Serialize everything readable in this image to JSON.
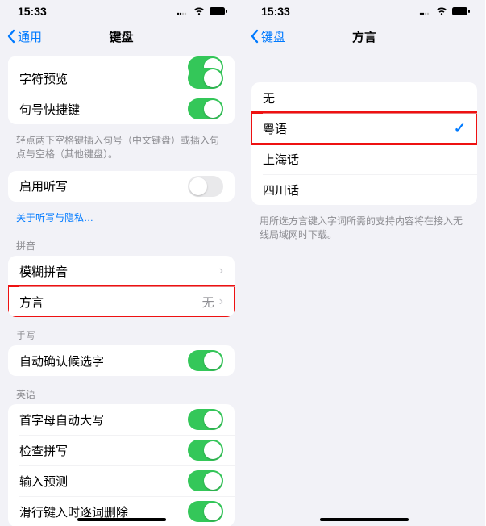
{
  "statusbar": {
    "time": "15:33"
  },
  "left": {
    "nav": {
      "back": "通用",
      "title": "键盘"
    },
    "rows": {
      "char_preview": "字符预览",
      "period_shortcut": "句号快捷键",
      "period_footer": "轻点两下空格键插入句号（中文键盘）或插入句点与空格（其他键盘）。",
      "dictation": "启用听写",
      "dictation_link": "关于听写与隐私…",
      "pinyin_header": "拼音",
      "fuzzy_pinyin": "模糊拼音",
      "dialect": "方言",
      "dialect_value": "无",
      "handwriting_header": "手写",
      "auto_confirm": "自动确认候选字",
      "english_header": "英语",
      "auto_cap": "首字母自动大写",
      "check_spelling": "检查拼写",
      "predictive": "输入预测",
      "slide_delete": "滑行键入时逐词删除"
    }
  },
  "right": {
    "nav": {
      "back": "键盘",
      "title": "方言"
    },
    "options": {
      "none": "无",
      "cantonese": "粤语",
      "shanghainese": "上海话",
      "sichuanese": "四川话"
    },
    "footer": "用所选方言键入字词所需的支持内容将在接入无线局域网时下载。"
  },
  "chart_data": null
}
